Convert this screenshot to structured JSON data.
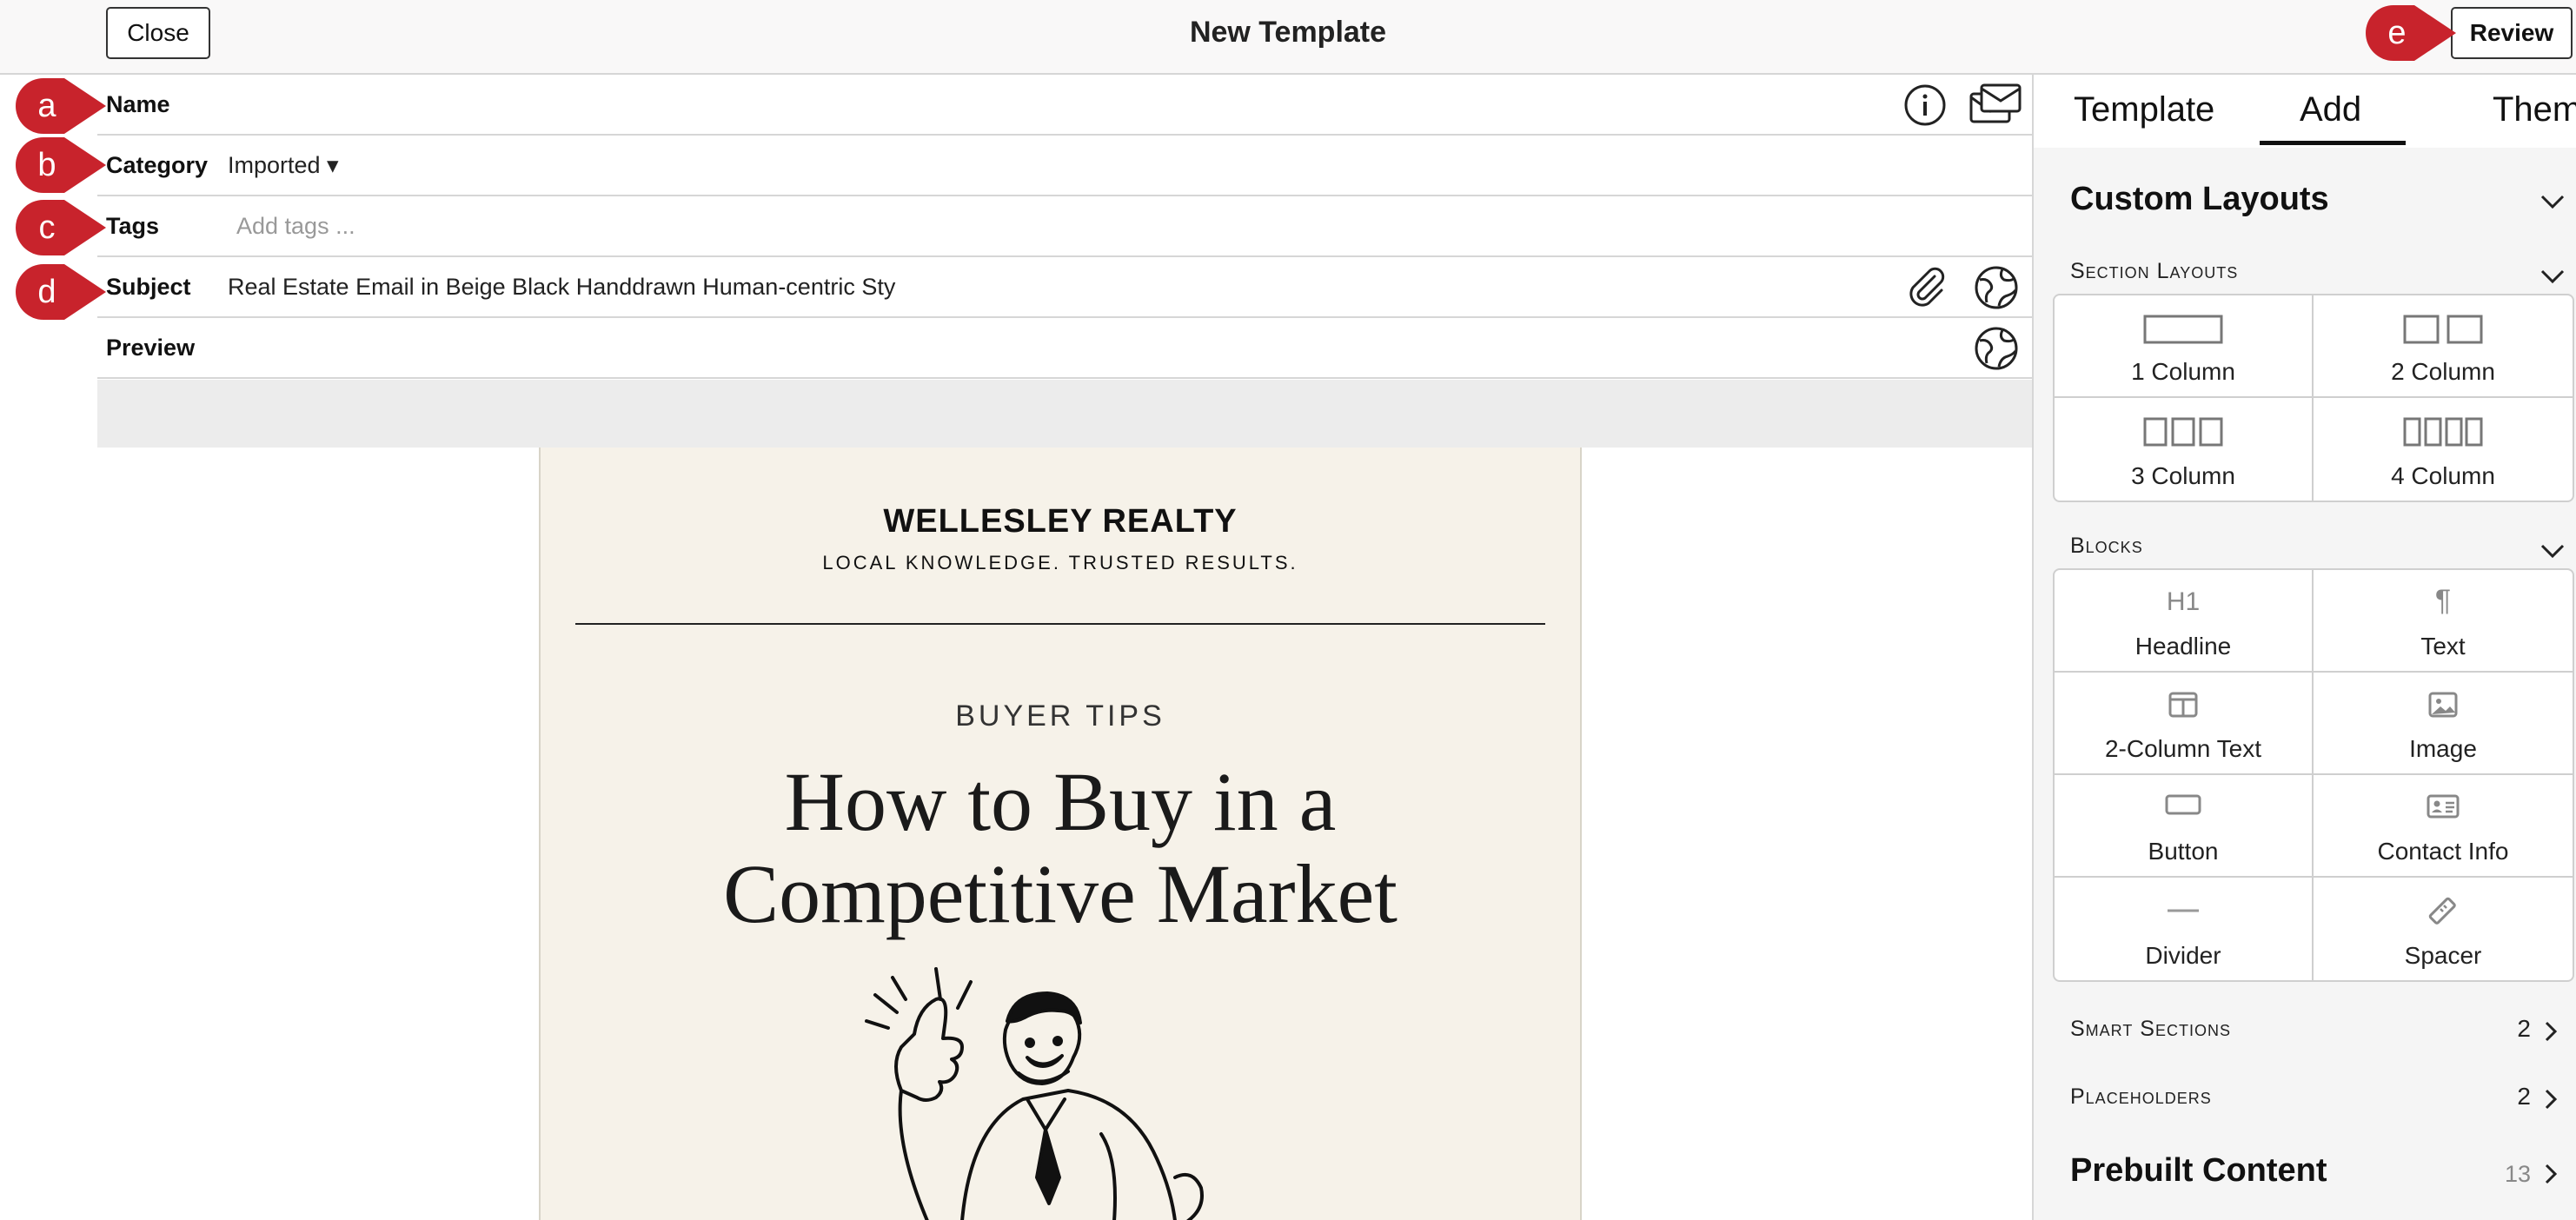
{
  "topbar": {
    "close_label": "Close",
    "title": "New Template",
    "review_label": "Review"
  },
  "markers": {
    "a": "a",
    "b": "b",
    "c": "c",
    "d": "d",
    "e": "e",
    "color": "#c8232c"
  },
  "form": {
    "name_label": "Name",
    "category_label": "Category",
    "category_value": "Imported ▾",
    "tags_label": "Tags",
    "tags_placeholder": "Add tags ...",
    "subject_label": "Subject",
    "subject_value": "Real Estate Email in Beige Black Handdrawn Human-centric Sty",
    "preview_label": "Preview"
  },
  "icons": {
    "info": "info-icon",
    "mail": "mail-settings-icon",
    "paperclip": "paperclip-icon",
    "globe": "globe-icon"
  },
  "email": {
    "brand": "WELLESLEY REALTY",
    "tagline": "LOCAL KNOWLEDGE. TRUSTED RESULTS.",
    "kicker": "BUYER TIPS",
    "headline_line1": "How to Buy in a",
    "headline_line2": "Competitive Market",
    "background": "#f6f2e9"
  },
  "panel": {
    "tabs": [
      "Template",
      "Add",
      "Theme"
    ],
    "active_tab": "Add",
    "custom_layouts": "Custom Layouts",
    "section_layouts": "Section Layouts",
    "layouts": [
      "1 Column",
      "2 Column",
      "3 Column",
      "4 Column"
    ],
    "blocks_heading": "Blocks",
    "blocks": [
      "Headline",
      "Text",
      "2-Column Text",
      "Image",
      "Button",
      "Contact Info",
      "Divider",
      "Spacer"
    ],
    "smart_sections": {
      "label": "Smart Sections",
      "count": "2"
    },
    "placeholders": {
      "label": "Placeholders",
      "count": "2"
    },
    "prebuilt": {
      "label": "Prebuilt Content",
      "count": "13"
    },
    "headline_glyph": "H1",
    "text_glyph": "¶"
  }
}
